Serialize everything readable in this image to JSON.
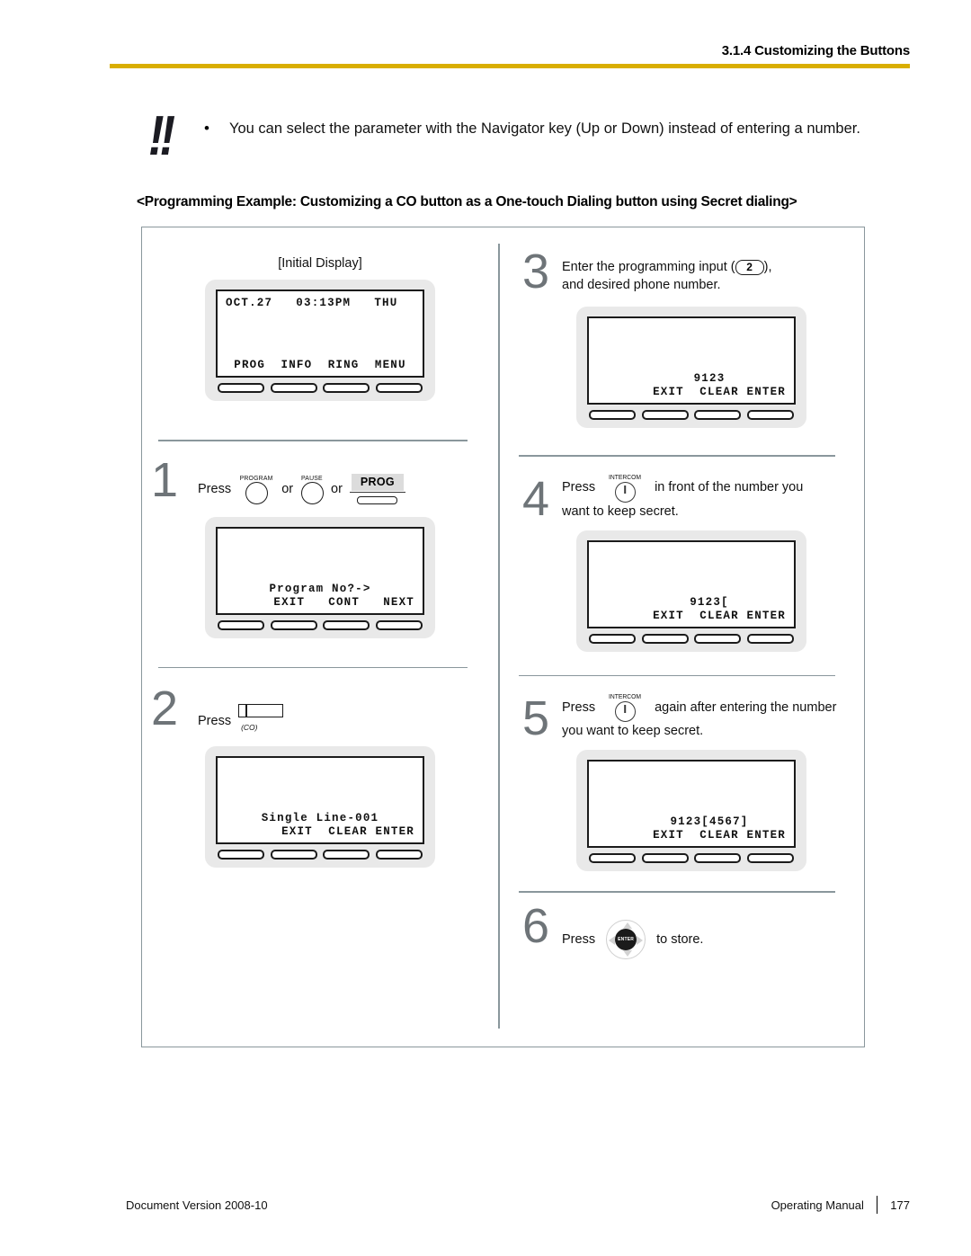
{
  "header": {
    "section_title": "3.1.4 Customizing the Buttons",
    "rule_color": "#d9ae00"
  },
  "note": {
    "icon": "double-exclamation-icon",
    "icon_glyph": "!!",
    "bullet": "•",
    "text": "You can select the parameter with the Navigator key (Up or Down) instead of entering a number."
  },
  "example_heading": "<Programming Example: Customizing a CO button as a One-touch Dialing button using Secret dialing>",
  "initial_display": {
    "caption": "[Initial Display]",
    "lcd": {
      "top_line": "OCT.27   03:13PM   THU",
      "value_line": "",
      "softkey_line": "PROG  INFO  RING  MENU"
    }
  },
  "steps": [
    {
      "number": "1",
      "press_label": "Press",
      "or_label": "or",
      "keys": [
        {
          "type": "round-key",
          "label": "PROGRAM",
          "name": "program-key-icon"
        },
        {
          "type": "round-key",
          "label": "PAUSE",
          "name": "pause-key-icon"
        },
        {
          "type": "prog-softkey",
          "label": "PROG",
          "name": "prog-softkey-icon"
        }
      ],
      "lcd": {
        "top_line": "",
        "value_line": "Program No?->",
        "softkey_line": "EXIT   CONT   NEXT"
      }
    },
    {
      "number": "2",
      "press_label": "Press",
      "keys": [
        {
          "type": "co-key",
          "label": "",
          "caption": "(CO)",
          "name": "co-button-icon"
        }
      ],
      "lcd": {
        "top_line": "",
        "value_line": "Single Line-001",
        "softkey_line": "EXIT  CLEAR ENTER"
      }
    },
    {
      "number": "3",
      "instruction_pre": "Enter the programming input (",
      "key_label": "2",
      "instruction_post": "),",
      "instruction_line2": "and desired phone number.",
      "lcd": {
        "top_line": "",
        "value_line": "9123",
        "softkey_line": "EXIT  CLEAR ENTER"
      }
    },
    {
      "number": "4",
      "press_label": "Press",
      "key_label": "INTERCOM",
      "instruction_post": "in front of the number you",
      "instruction_line2": "want to keep secret.",
      "lcd": {
        "top_line": "",
        "value_line": "9123[",
        "softkey_line": "EXIT  CLEAR ENTER"
      }
    },
    {
      "number": "5",
      "press_label": "Press",
      "key_label": "INTERCOM",
      "instruction_post": "again after entering the number",
      "instruction_line2": "you want to keep secret.",
      "lcd": {
        "top_line": "",
        "value_line": "9123[4567]",
        "softkey_line": "EXIT  CLEAR ENTER"
      }
    },
    {
      "number": "6",
      "press_label": "Press",
      "key_label": "ENTER",
      "instruction_post": "to store."
    }
  ],
  "footer": {
    "document_version": "Document Version  2008-10",
    "manual_name": "Operating Manual",
    "page_number": "177"
  }
}
